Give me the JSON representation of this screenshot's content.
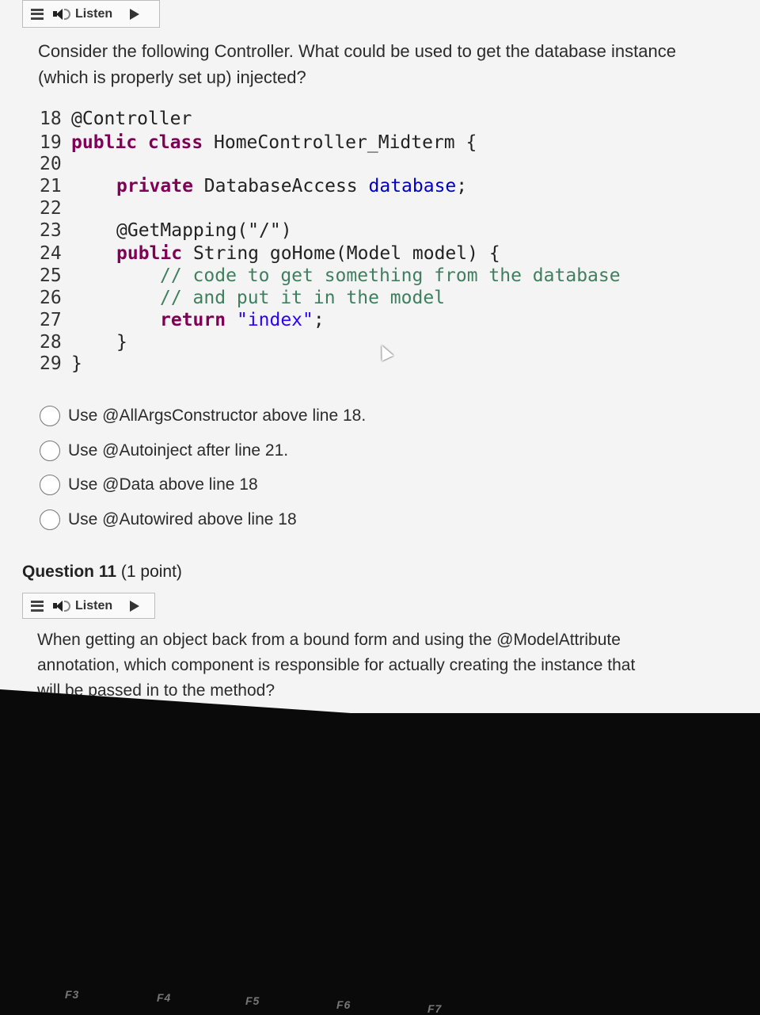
{
  "listen_bar_1": {
    "label": "Listen"
  },
  "question_prev": {
    "text_line1": "Consider the following Controller. What could be used to get the database instance",
    "text_line2": "(which is properly set up) injected?"
  },
  "code": {
    "line_numbers": [
      "18",
      "19",
      "20",
      "21",
      "22",
      "23",
      "24",
      "25",
      "26",
      "27",
      "28",
      "29"
    ],
    "l18": "@Controller",
    "l19_kw": "public class",
    "l19_rest": " HomeController_Midterm {",
    "l21_kw": "private",
    "l21_type": " DatabaseAccess ",
    "l21_field": "database",
    "l21_end": ";",
    "l23": "@GetMapping(\"/\")",
    "l24_kw": "public",
    "l24_rest": " String goHome(Model model) {",
    "l25": "// code to get something from the database",
    "l26": "// and put it in the model",
    "l27_kw": "return",
    "l27_str": " \"index\"",
    "l27_end": ";",
    "l28": "}",
    "l29": "}"
  },
  "options": [
    {
      "label": "Use @AllArgsConstructor above line 18."
    },
    {
      "label": "Use @Autoinject after line 21."
    },
    {
      "label": "Use @Data above line 18"
    },
    {
      "label": "Use @Autowired above line 18"
    }
  ],
  "question_11": {
    "title": "Question 11",
    "points": "(1 point)",
    "listen_label": "Listen",
    "text_line1": "When getting an object back from a bound form and using the @ModelAttribute",
    "text_line2": "annotation, which component is responsible for actually creating the instance that",
    "text_line3": "will be passed in to the method?"
  },
  "keyboard": {
    "keys": [
      "F3",
      "F4",
      "F5",
      "F6",
      "F7"
    ]
  }
}
